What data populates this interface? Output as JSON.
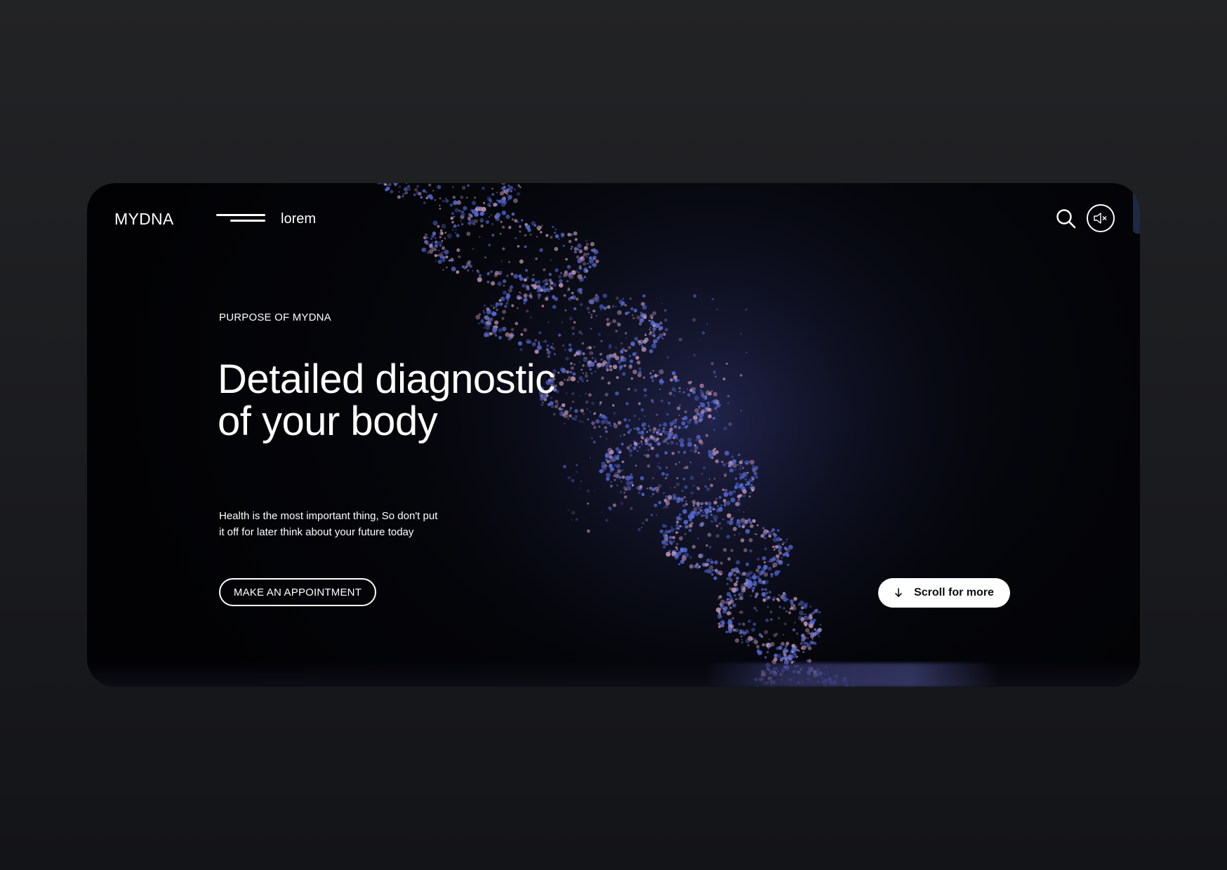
{
  "header": {
    "logo": "MYDNA",
    "menu_label": "lorem",
    "icons": {
      "menu": "menu-lines-icon",
      "search": "search-icon",
      "sound": "speaker-muted-icon"
    }
  },
  "hero": {
    "kicker": "PURPOSE OF MYDNA",
    "headline_line1": "Detailed diagnostic",
    "headline_line2": "of your body",
    "body_line1": "Health is the most important thing, So don't put",
    "body_line2": "it off for later think about your future today",
    "cta_label": "MAKE AN APPOINTMENT",
    "scroll_label": "Scroll for more",
    "scroll_icon": "arrow-down-icon"
  },
  "colors": {
    "page_background": "#1f2022",
    "hero_background": "#040509",
    "text": "#ffffff",
    "dna_blue": "#5a6fe0",
    "dna_pink": "#c89bb8",
    "scroll_button_bg": "#ffffff"
  }
}
